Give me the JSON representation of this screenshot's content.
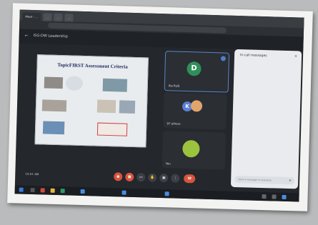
{
  "browser": {
    "tabs": [
      {
        "label": "Meet - …"
      },
      {
        "label": "…"
      },
      {
        "label": "…"
      },
      {
        "label": "…"
      }
    ]
  },
  "meeting": {
    "title": "ISG-DW Leadership",
    "time": "10:51 AM"
  },
  "slide": {
    "title": "TopicFIRST Assessment Criteria",
    "header_left": "",
    "header_right": ""
  },
  "participants": [
    {
      "initial": "D",
      "name": "Ilia RUS",
      "avatar_color": "#2f8f5a",
      "speaking": true
    },
    {
      "initial": "K",
      "name": "97 others",
      "avatar_color": "#5b7fd1"
    },
    {
      "initial": "",
      "name": "You",
      "avatar_color": "#9bc33d"
    }
  ],
  "chat": {
    "title": "In-call messages",
    "messages": [
      {
        "name": "",
        "text": ""
      },
      {
        "name": "",
        "text": ""
      },
      {
        "name": "",
        "text": ""
      },
      {
        "name": "",
        "text": ""
      },
      {
        "name": "",
        "text": ""
      }
    ],
    "input_placeholder": "Send a message to everyone"
  },
  "colors": {
    "end_call": "#d9533b",
    "accent": "#5a86c8"
  }
}
